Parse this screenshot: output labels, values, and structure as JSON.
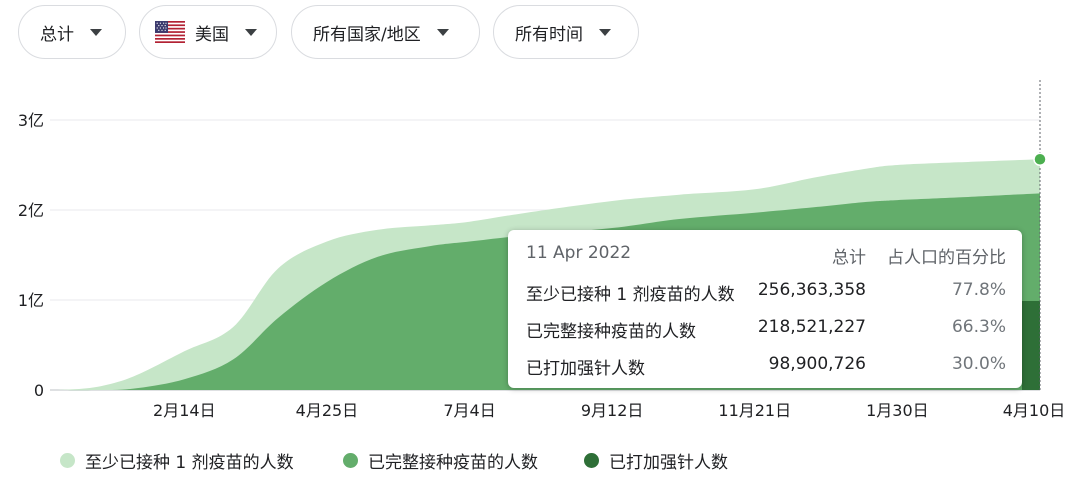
{
  "filters": {
    "metric": {
      "label": "总计"
    },
    "location": {
      "label": "美国",
      "flag": "us-flag-icon"
    },
    "region": {
      "label": "所有国家/地区"
    },
    "time": {
      "label": "所有时间"
    }
  },
  "colors": {
    "at_least_one": "#c6e6c8",
    "fully": "#63ad6b",
    "booster": "#2e6f37",
    "grid": "#e8eaed",
    "axis_text": "#202124"
  },
  "tooltip": {
    "date": "11 Apr 2022",
    "col_total": "总计",
    "col_pct": "占人口的百分比",
    "rows": [
      {
        "name": "至少已接种 1 剂疫苗的人数",
        "total": "256,363,358",
        "pct": "77.8%"
      },
      {
        "name": "已完整接种疫苗的人数",
        "total": "218,521,227",
        "pct": "66.3%"
      },
      {
        "name": "已打加强针人数",
        "total": "98,900,726",
        "pct": "30.0%"
      }
    ]
  },
  "legend": [
    {
      "label": "至少已接种 1 剂疫苗的人数",
      "color": "#c6e6c8"
    },
    {
      "label": "已完整接种疫苗的人数",
      "color": "#63ad6b"
    },
    {
      "label": "已打加强针人数",
      "color": "#2e6f37"
    }
  ],
  "chart_data": {
    "type": "area",
    "x_labels": [
      "2月14日",
      "4月25日",
      "7月4日",
      "9月12日",
      "11月21日",
      "1月30日",
      "4月10日"
    ],
    "y_tick_labels": [
      "0",
      "1亿",
      "2亿",
      "3亿"
    ],
    "y_ticks": [
      0,
      100000000,
      200000000,
      300000000
    ],
    "ylim": [
      0,
      300000000
    ],
    "x": [
      "2020-12-14",
      "2021-01-01",
      "2021-01-20",
      "2021-02-14",
      "2021-03-10",
      "2021-04-01",
      "2021-04-25",
      "2021-05-20",
      "2021-06-15",
      "2021-07-04",
      "2021-08-01",
      "2021-09-12",
      "2021-10-15",
      "2021-11-21",
      "2021-12-20",
      "2022-01-15",
      "2022-01-30",
      "2022-03-01",
      "2022-04-10"
    ],
    "series": [
      {
        "name": "至少已接种 1 剂疫苗的人数",
        "color": "#c6e6c8",
        "values": [
          0,
          3000000,
          15000000,
          43000000,
          70000000,
          135000000,
          165000000,
          178000000,
          183000000,
          187000000,
          197000000,
          210000000,
          217000000,
          223000000,
          236000000,
          246000000,
          250000000,
          253000000,
          256363358
        ]
      },
      {
        "name": "已完整接种疫苗的人数",
        "color": "#63ad6b",
        "values": [
          0,
          0,
          1500000,
          12000000,
          34000000,
          80000000,
          120000000,
          148000000,
          160000000,
          165000000,
          172000000,
          180000000,
          190000000,
          197000000,
          203000000,
          209000000,
          211000000,
          214000000,
          218521227
        ]
      },
      {
        "name": "已打加强针人数",
        "color": "#2e6f37",
        "values": [
          0,
          0,
          0,
          0,
          0,
          0,
          0,
          0,
          0,
          0,
          0,
          0,
          0,
          0,
          0,
          0,
          0,
          0,
          98900726
        ]
      }
    ]
  }
}
